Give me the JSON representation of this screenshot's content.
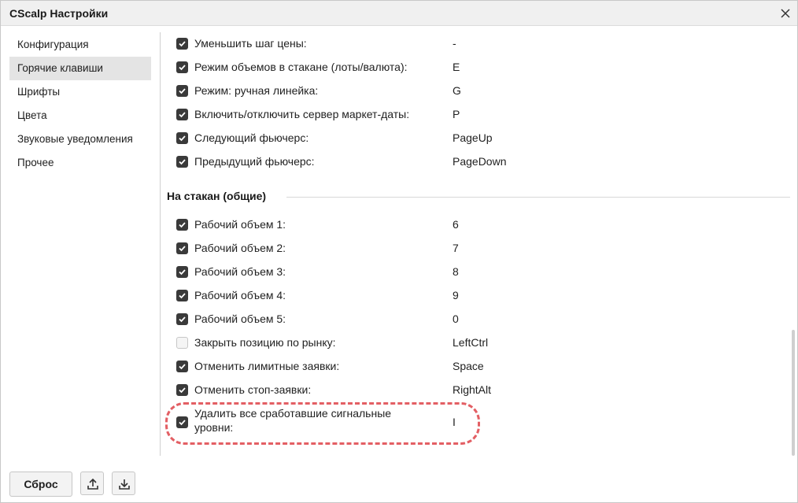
{
  "window": {
    "title": "CScalp Настройки"
  },
  "sidebar": {
    "items": [
      {
        "label": "Конфигурация",
        "active": false
      },
      {
        "label": "Горячие клавиши",
        "active": true
      },
      {
        "label": "Шрифты",
        "active": false
      },
      {
        "label": "Цвета",
        "active": false
      },
      {
        "label": "Звуковые уведомления",
        "active": false
      },
      {
        "label": "Прочее",
        "active": false
      }
    ]
  },
  "hotkeys_top": [
    {
      "label": "Уменьшить шаг цены:",
      "value": "-",
      "checked": true
    },
    {
      "label": "Режим объемов в стакане (лоты/валюта):",
      "value": "E",
      "checked": true
    },
    {
      "label": "Режим: ручная линейка:",
      "value": "G",
      "checked": true
    },
    {
      "label": "Включить/отключить сервер маркет-даты:",
      "value": "P",
      "checked": true
    },
    {
      "label": "Следующий фьючерс:",
      "value": "PageUp",
      "checked": true
    },
    {
      "label": "Предыдущий фьючерс:",
      "value": "PageDown",
      "checked": true
    }
  ],
  "section_stakan": {
    "title": "На стакан (общие)",
    "items": [
      {
        "label": "Рабочий объем 1:",
        "value": "6",
        "checked": true
      },
      {
        "label": "Рабочий объем 2:",
        "value": "7",
        "checked": true
      },
      {
        "label": "Рабочий объем 3:",
        "value": "8",
        "checked": true
      },
      {
        "label": "Рабочий объем 4:",
        "value": "9",
        "checked": true
      },
      {
        "label": "Рабочий объем 5:",
        "value": "0",
        "checked": true
      },
      {
        "label": "Закрыть позицию по рынку:",
        "value": "LeftCtrl",
        "checked": false
      },
      {
        "label": "Отменить лимитные заявки:",
        "value": "Space",
        "checked": true
      },
      {
        "label": "Отменить стоп-заявки:",
        "value": "RightAlt",
        "checked": true
      },
      {
        "label": "Удалить все сработавшие сигнальные уровни:",
        "value": "I",
        "checked": true
      }
    ]
  },
  "footer": {
    "reset_label": "Сброс",
    "export_icon": "upload-icon",
    "import_icon": "download-icon"
  },
  "colors": {
    "highlight": "#e35f64",
    "checkbox": "#3a3a3a",
    "active_item": "#e4e4e4"
  }
}
